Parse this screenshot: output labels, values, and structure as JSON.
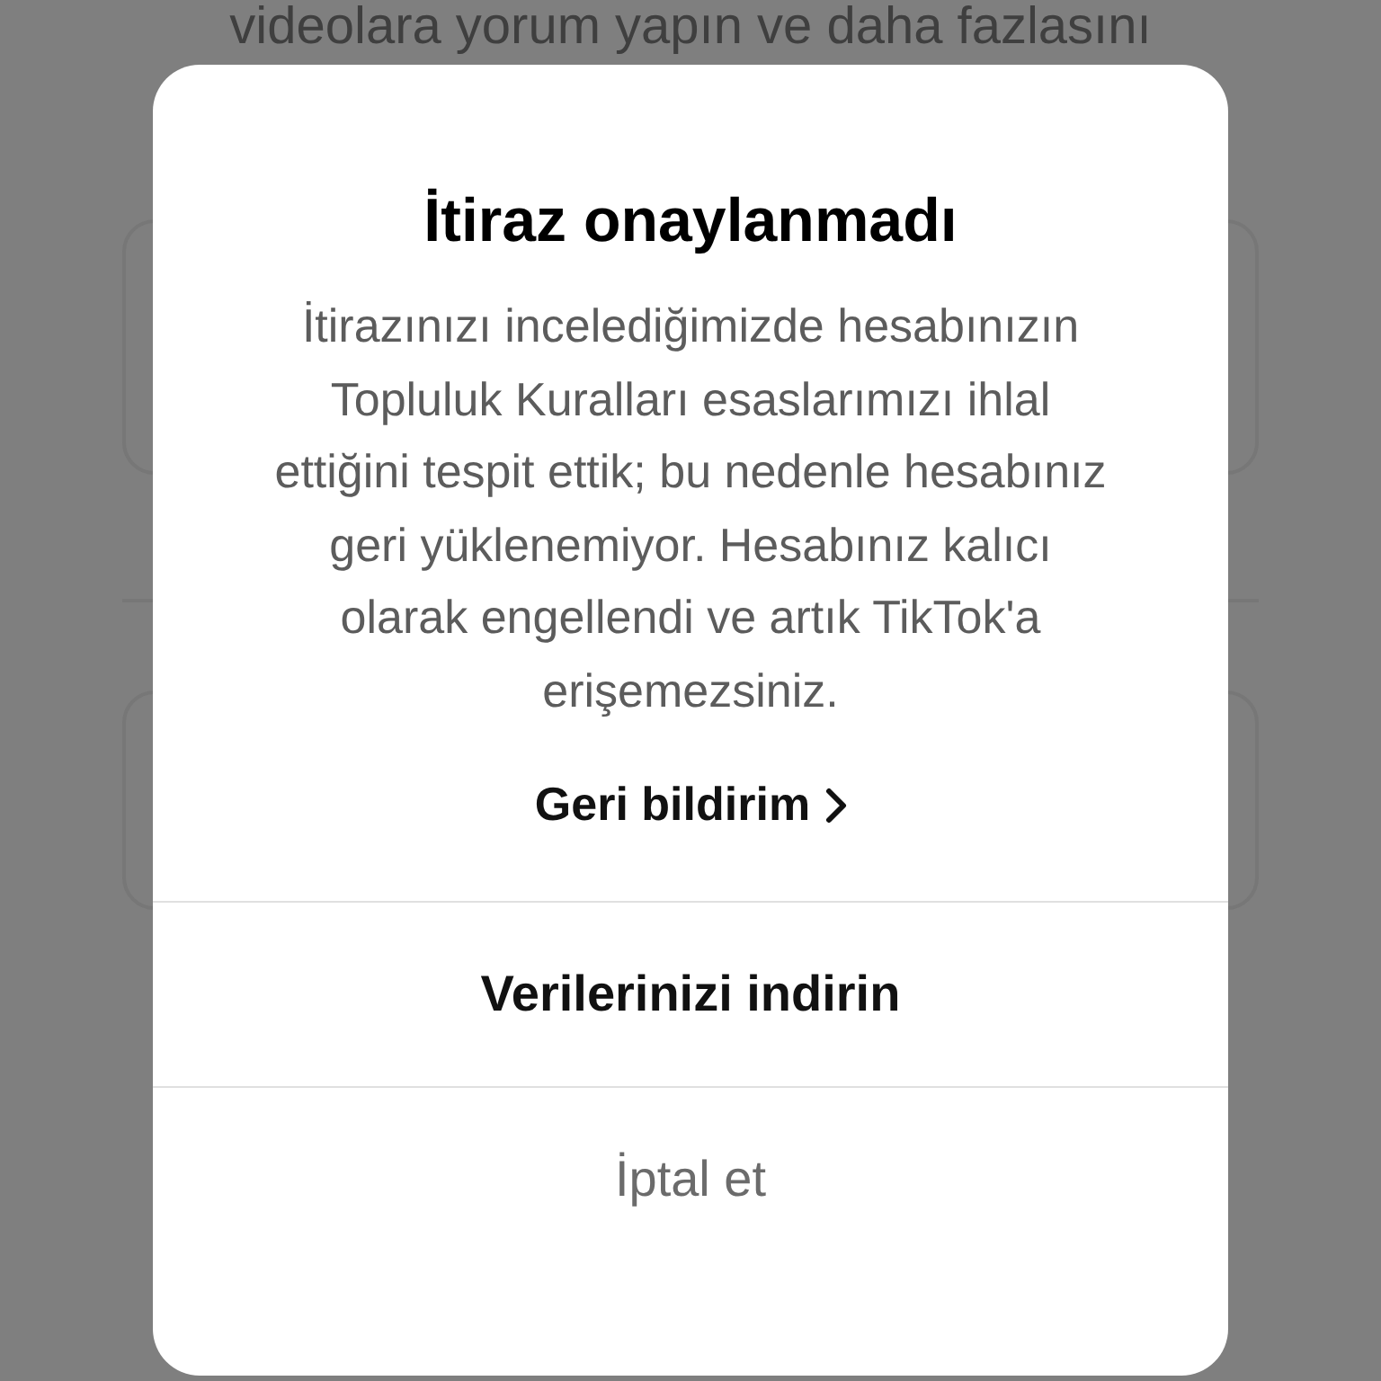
{
  "background": {
    "text": "videolara yorum yapın ve daha fazlasını"
  },
  "dialog": {
    "title": "İtiraz onaylanmadı",
    "message": "İtirazınızı incelediğimizde hesabınızın Topluluk Kuralları esaslarımızı ihlal ettiğini tespit ettik; bu nedenle hesabınız geri yüklenemiyor. Hesabınız kalıcı olarak engellendi ve artık TikTok'a erişemezsiniz.",
    "link": "Geri bildirim",
    "actions": [
      {
        "label": "Verilerinizi indirin",
        "kind": "primary"
      },
      {
        "label": "İptal et",
        "kind": "cancel"
      }
    ]
  }
}
